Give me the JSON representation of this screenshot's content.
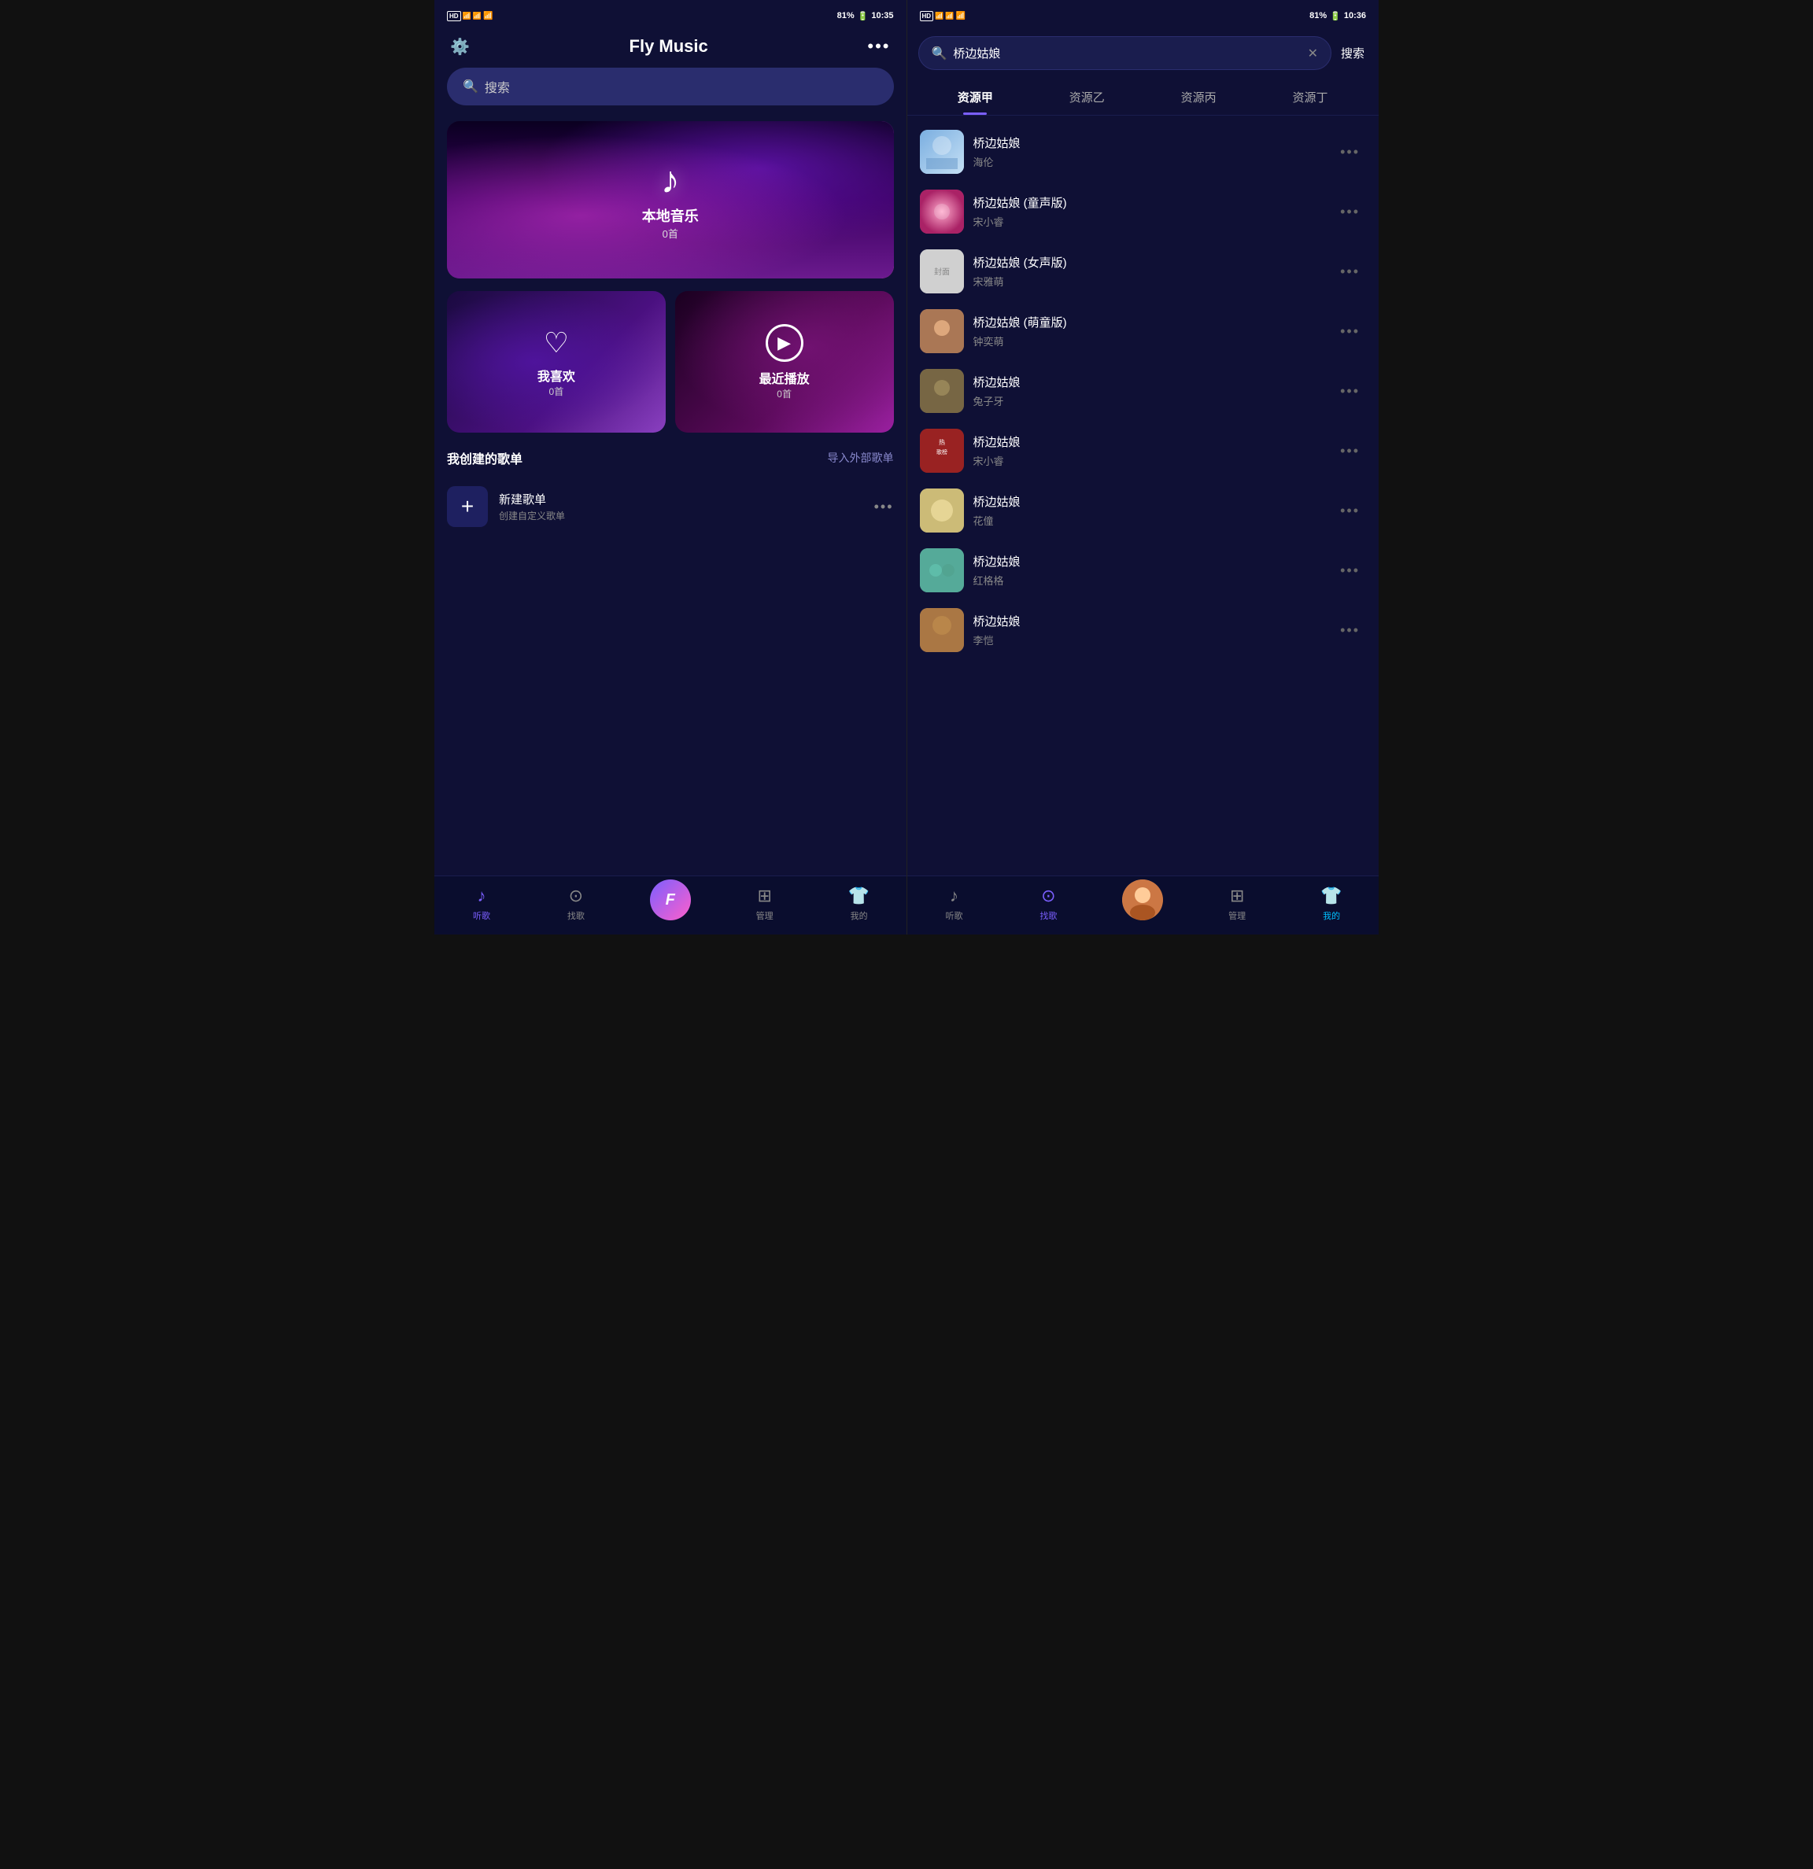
{
  "left_phone": {
    "status": {
      "left": "HD 46 46 WiFi",
      "battery": "81%",
      "time": "10:35"
    },
    "header": {
      "settings_icon": "⚙",
      "title": "Fly Music",
      "more_icon": "..."
    },
    "search_placeholder": "搜索",
    "banner": {
      "icon": "♪",
      "title": "本地音乐",
      "count": "0首"
    },
    "card_left": {
      "icon": "♡",
      "title": "我喜欢",
      "count": "0首"
    },
    "card_right": {
      "icon": "▶",
      "title": "最近播放",
      "count": "0首"
    },
    "section": {
      "title": "我创建的歌单",
      "action": "导入外部歌单"
    },
    "playlist": {
      "icon": "+",
      "name": "新建歌单",
      "desc": "创建自定义歌单",
      "more": "..."
    },
    "nav": [
      {
        "icon": "♪",
        "label": "听歌",
        "active": true
      },
      {
        "icon": "◎",
        "label": "找歌",
        "active": false
      },
      {
        "icon": "F",
        "label": "",
        "active": false,
        "center": true
      },
      {
        "icon": "▣",
        "label": "管理",
        "active": false
      },
      {
        "icon": "👕",
        "label": "我的",
        "active": false
      }
    ]
  },
  "right_phone": {
    "status": {
      "left": "HD 46 46 WiFi",
      "battery": "81%",
      "time": "10:36"
    },
    "search": {
      "query": "桥边姑娘",
      "clear_icon": "✕",
      "button": "搜索"
    },
    "tabs": [
      {
        "label": "资源甲",
        "active": true
      },
      {
        "label": "资源乙",
        "active": false
      },
      {
        "label": "资源丙",
        "active": false
      },
      {
        "label": "资源丁",
        "active": false
      }
    ],
    "songs": [
      {
        "title": "桥边姑娘",
        "artist": "海伦",
        "thumb_class": "thumb-1"
      },
      {
        "title": "桥边姑娘 (童声版)",
        "artist": "宋小睿",
        "thumb_class": "thumb-2"
      },
      {
        "title": "桥边姑娘 (女声版)",
        "artist": "宋雅萌",
        "thumb_class": "thumb-3"
      },
      {
        "title": "桥边姑娘 (萌童版)",
        "artist": "钟奕萌",
        "thumb_class": "thumb-4"
      },
      {
        "title": "桥边姑娘",
        "artist": "兔子牙",
        "thumb_class": "thumb-5"
      },
      {
        "title": "桥边姑娘",
        "artist": "宋小睿",
        "thumb_class": "thumb-6"
      },
      {
        "title": "桥边姑娘",
        "artist": "花僮",
        "thumb_class": "thumb-7"
      },
      {
        "title": "桥边姑娘",
        "artist": "红格格",
        "thumb_class": "thumb-8"
      },
      {
        "title": "桥边姑娘",
        "artist": "李恺",
        "thumb_class": "thumb-9"
      }
    ],
    "nav": [
      {
        "icon": "♪",
        "label": "听歌",
        "active": false
      },
      {
        "icon": "◎",
        "label": "找歌",
        "active": true
      },
      {
        "label": "",
        "center": true
      },
      {
        "icon": "▣",
        "label": "管理",
        "active": false
      },
      {
        "icon": "👕",
        "label": "我的",
        "active": false
      }
    ]
  }
}
